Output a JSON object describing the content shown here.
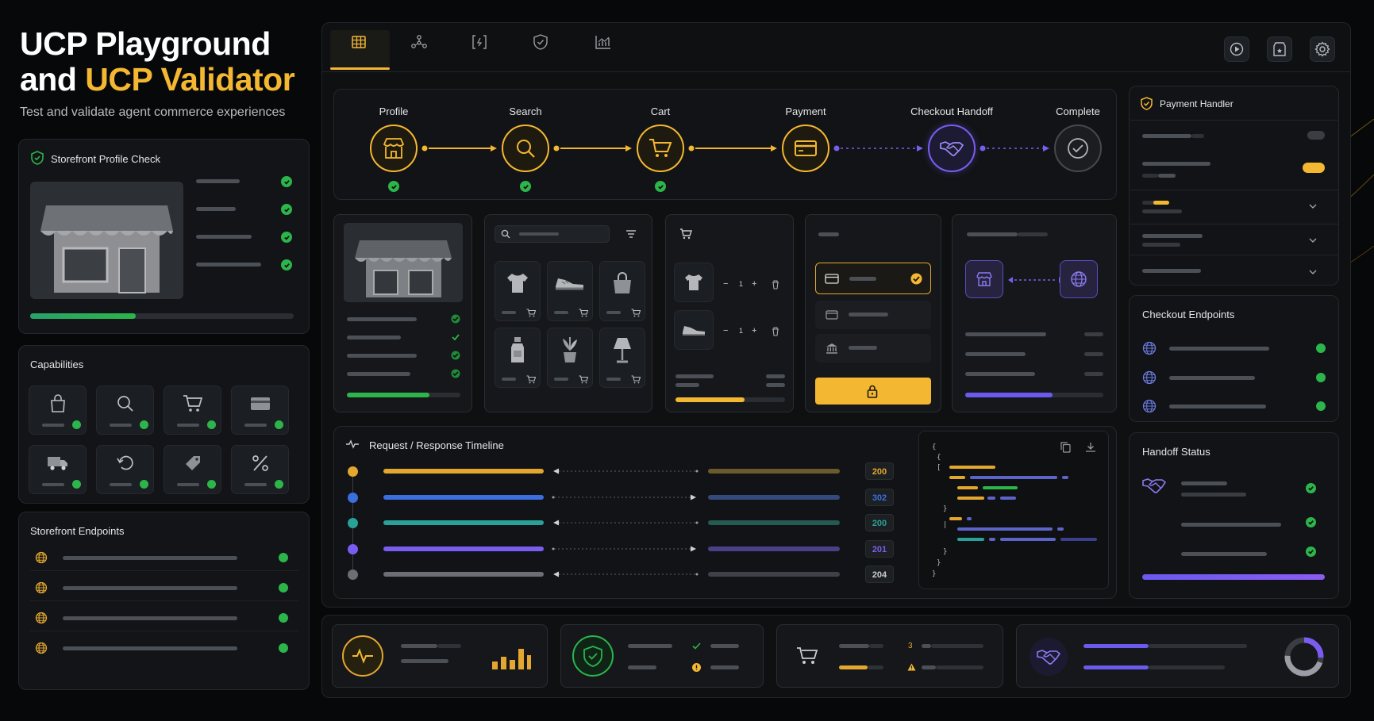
{
  "header": {
    "title_line1": "UCP Playground",
    "title_and": "and ",
    "title_accent": "UCP Validator",
    "subtitle": "Test and validate agent commerce experiences"
  },
  "colors": {
    "accent": "#f4b731",
    "success": "#2cb54a",
    "purple": "#7b5cf0",
    "blue": "#3b6fe0",
    "teal": "#2aa198"
  },
  "tabs": [
    {
      "icon": "grid-icon",
      "active": true
    },
    {
      "icon": "network-icon",
      "active": false
    },
    {
      "icon": "code-bracket-icon",
      "active": false
    },
    {
      "icon": "shield-icon",
      "active": false
    },
    {
      "icon": "chart-icon",
      "active": false
    }
  ],
  "toolbar_icons": [
    "play-icon",
    "storefront-icon",
    "settings-icon"
  ],
  "storefront_check": {
    "title": "Storefront Profile Check",
    "progress": 0.4
  },
  "capabilities": {
    "title": "Capabilities",
    "items": [
      "bag-icon",
      "search-icon",
      "cart-icon",
      "card-icon",
      "truck-icon",
      "returns-icon",
      "tag-icon",
      "percent-icon"
    ]
  },
  "storefront_endpoints": {
    "title": "Storefront Endpoints",
    "count": 4
  },
  "flow": {
    "steps": [
      {
        "label": "Profile",
        "status": "done"
      },
      {
        "label": "Search",
        "status": "done"
      },
      {
        "label": "Cart",
        "status": "done"
      },
      {
        "label": "Payment",
        "status": "active"
      },
      {
        "label": "Checkout Handoff",
        "status": "pending"
      },
      {
        "label": "Complete",
        "status": "pending"
      }
    ]
  },
  "cart_card": {
    "qty1": "1",
    "qty2": "1"
  },
  "timeline": {
    "title": "Request / Response Timeline",
    "rows": [
      {
        "code": "200",
        "color": "#e3a72f",
        "dir": "in"
      },
      {
        "code": "302",
        "color": "#3b6fe0",
        "dir": "out"
      },
      {
        "code": "200",
        "color": "#2aa198",
        "dir": "in"
      },
      {
        "code": "201",
        "color": "#7b5cf0",
        "dir": "out"
      },
      {
        "code": "204",
        "color": "#6b6f75",
        "dir": "in"
      }
    ]
  },
  "payment_handler": {
    "title": "Payment Handler"
  },
  "checkout_endpoints": {
    "title": "Checkout Endpoints"
  },
  "handoff_status": {
    "title": "Handoff Status",
    "progress": 1.0
  },
  "bottom_stats": {
    "cart_count": "3"
  }
}
